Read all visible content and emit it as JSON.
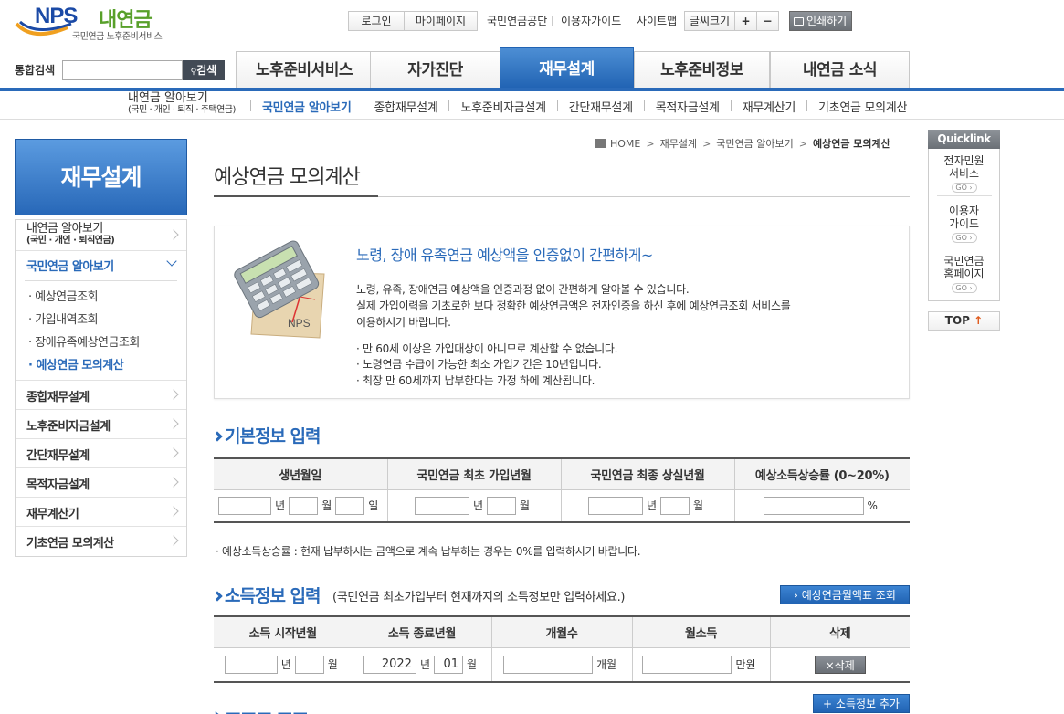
{
  "header": {
    "logo_brand": "NPS",
    "logo_name": "내연금",
    "logo_subtitle": "국민연금 노후준비서비스",
    "login": "로그인",
    "mypage": "마이페이지",
    "nps_link": "국민연금공단",
    "guide": "이용자가이드",
    "sitemap": "사이트맵",
    "font_size": "글씨크기",
    "font_plus": "+",
    "font_minus": "−",
    "print": "인쇄하기"
  },
  "search": {
    "label": "통합검색",
    "value": "",
    "button": "검색"
  },
  "gnb": {
    "tabs": [
      "노후준비서비스",
      "자가진단",
      "재무설계",
      "노후준비정보",
      "내연금 소식"
    ],
    "active_index": 2
  },
  "snb": {
    "first_line1": "내연금 알아보기",
    "first_line2": "(국민 · 개인 · 퇴직 · 주택연금)",
    "items": [
      "국민연금 알아보기",
      "종합재무설계",
      "노후준비자금설계",
      "간단재무설계",
      "목적자금설계",
      "재무계산기",
      "기초연금 모의계산"
    ]
  },
  "lnb": {
    "title": "재무설계",
    "item0_line1": "내연금 알아보기",
    "item0_line2": "(국민 · 개인 · 퇴직연금)",
    "item1": "국민연금 알아보기",
    "subs": [
      "예상연금조회",
      "가입내역조회",
      "장애유족예상연금조회",
      "예상연금 모의계산"
    ],
    "items": [
      "종합재무설계",
      "노후준비자금설계",
      "간단재무설계",
      "목적자금설계",
      "재무계산기",
      "기초연금 모의계산"
    ]
  },
  "breadcrumb": {
    "home": "HOME",
    "b1": "재무설계",
    "b2": "국민연금 알아보기",
    "current": "예상연금 모의계산"
  },
  "page_title": "예상연금 모의계산",
  "info": {
    "headline": "노령, 장애 유족연금 예상액을 인증없이 간편하게~",
    "p1": "노령, 유족, 장애연금 예상액을 인증과정 없이 간편하게 알아볼 수 있습니다.",
    "p2": "실제 가입이력을 기초로한 보다 정확한 예상연금액은 전자인증을 하신 후에 예상연금조회 서비스를",
    "p3": "이용하시기 바랍니다.",
    "b1": "· 만 60세 이상은 가입대상이 아니므로 계산할 수 없습니다.",
    "b2": "· 노령연금 수급이 가능한 최소 가입기간은 10년입니다.",
    "b3": "· 최장 만 60세까지 납부한다는 가정 하에 계산됩니다.",
    "image_label": "NPS"
  },
  "basic": {
    "title": "기본정보 입력",
    "headers": [
      "생년월일",
      "국민연금 최초 가입년월",
      "국민연금 최종 상실년월",
      "예상소득상승률 (0~20%)"
    ],
    "unit_year": "년",
    "unit_month": "월",
    "unit_day": "일",
    "unit_pct": "%",
    "note": "· 예상소득상승률 : 현재 납부하시는 금액으로 계속 납부하는 경우는 0%를 입력하시기 바랍니다."
  },
  "income": {
    "title": "소득정보 입력",
    "subtitle": "(국민연금 최초가입부터 현재까지의 소득정보만 입력하세요.)",
    "lookup_button": "› 예상연금월액표 조회",
    "headers": [
      "소득 시작년월",
      "소득 종료년월",
      "개월수",
      "월소득",
      "삭제"
    ],
    "end_year": "2022",
    "end_month": "01",
    "unit_year": "년",
    "unit_month": "월",
    "unit_count": "개월",
    "unit_won": "만원",
    "delete_button": "×삭제",
    "add_button": "+ 소득정보 추가"
  },
  "quicklink": {
    "title": "Quicklink",
    "items": [
      {
        "l1": "전자민원",
        "l2": "서비스"
      },
      {
        "l1": "이용자",
        "l2": "가이드"
      },
      {
        "l1": "국민연금",
        "l2": "홈페이지"
      }
    ],
    "go": "GO ›",
    "top": "TOP"
  },
  "colors": {
    "primary": "#2a6ab9",
    "button_dark": "#424a55"
  }
}
